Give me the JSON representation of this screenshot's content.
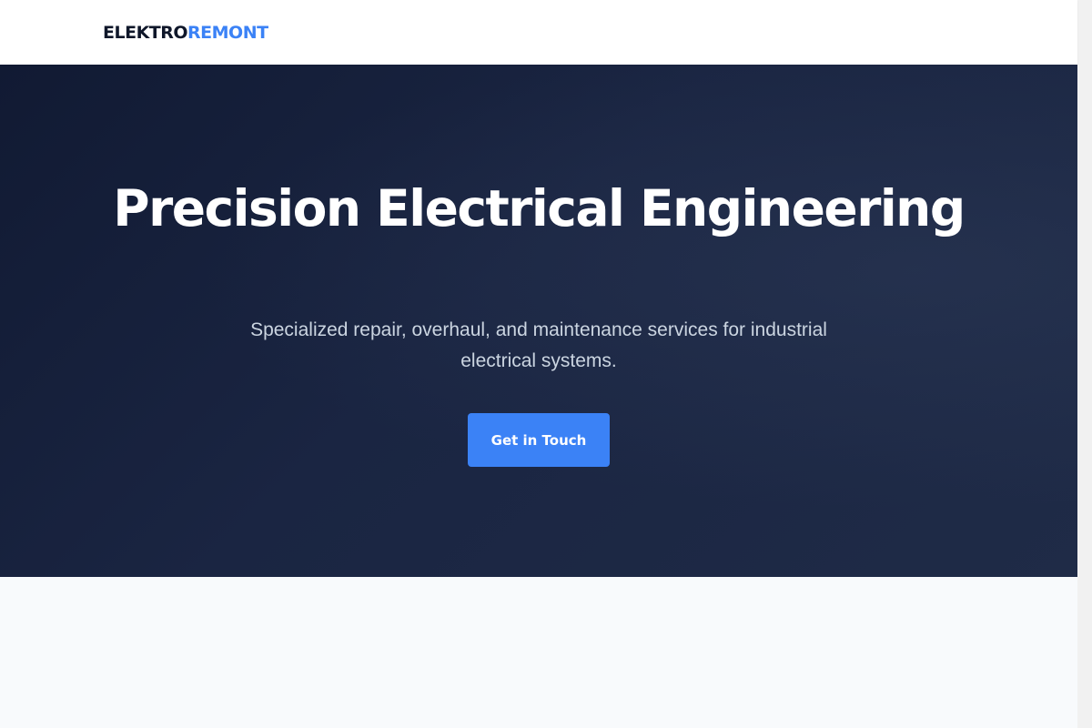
{
  "brand": {
    "logo_part_a": "ELEKTRO",
    "logo_part_b": "REMONT",
    "primary_color": "#0f172a",
    "accent_color": "#3b82f6"
  },
  "hero": {
    "title": "Precision Electrical Engineering",
    "subtitle": "Specialized repair, overhaul, and maintenance services for industrial electrical systems.",
    "cta_label": "Get in Touch",
    "background_color": "#1a2542"
  }
}
